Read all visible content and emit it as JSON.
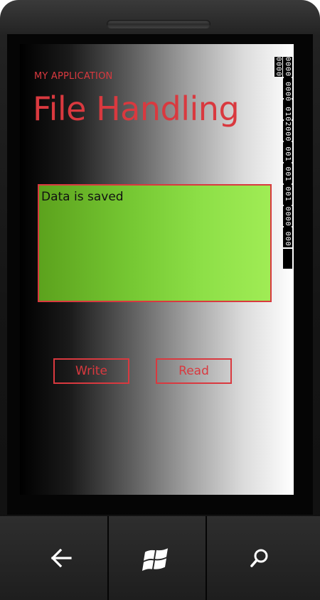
{
  "app": {
    "name": "MY APPLICATION",
    "page_title": "File Handling"
  },
  "content": {
    "textbox_value": "Data is saved"
  },
  "buttons": {
    "write_label": "Write",
    "read_label": "Read"
  },
  "overlay": {
    "frame_counter": "0000 0000 0102000 001 001 001 0000 000 0000"
  },
  "nav": {
    "back_icon": "back-arrow-icon",
    "start_icon": "windows-logo-icon",
    "search_icon": "search-icon"
  },
  "colors": {
    "accent": "#d9393f",
    "textbox_fill": "#8ddf47"
  }
}
